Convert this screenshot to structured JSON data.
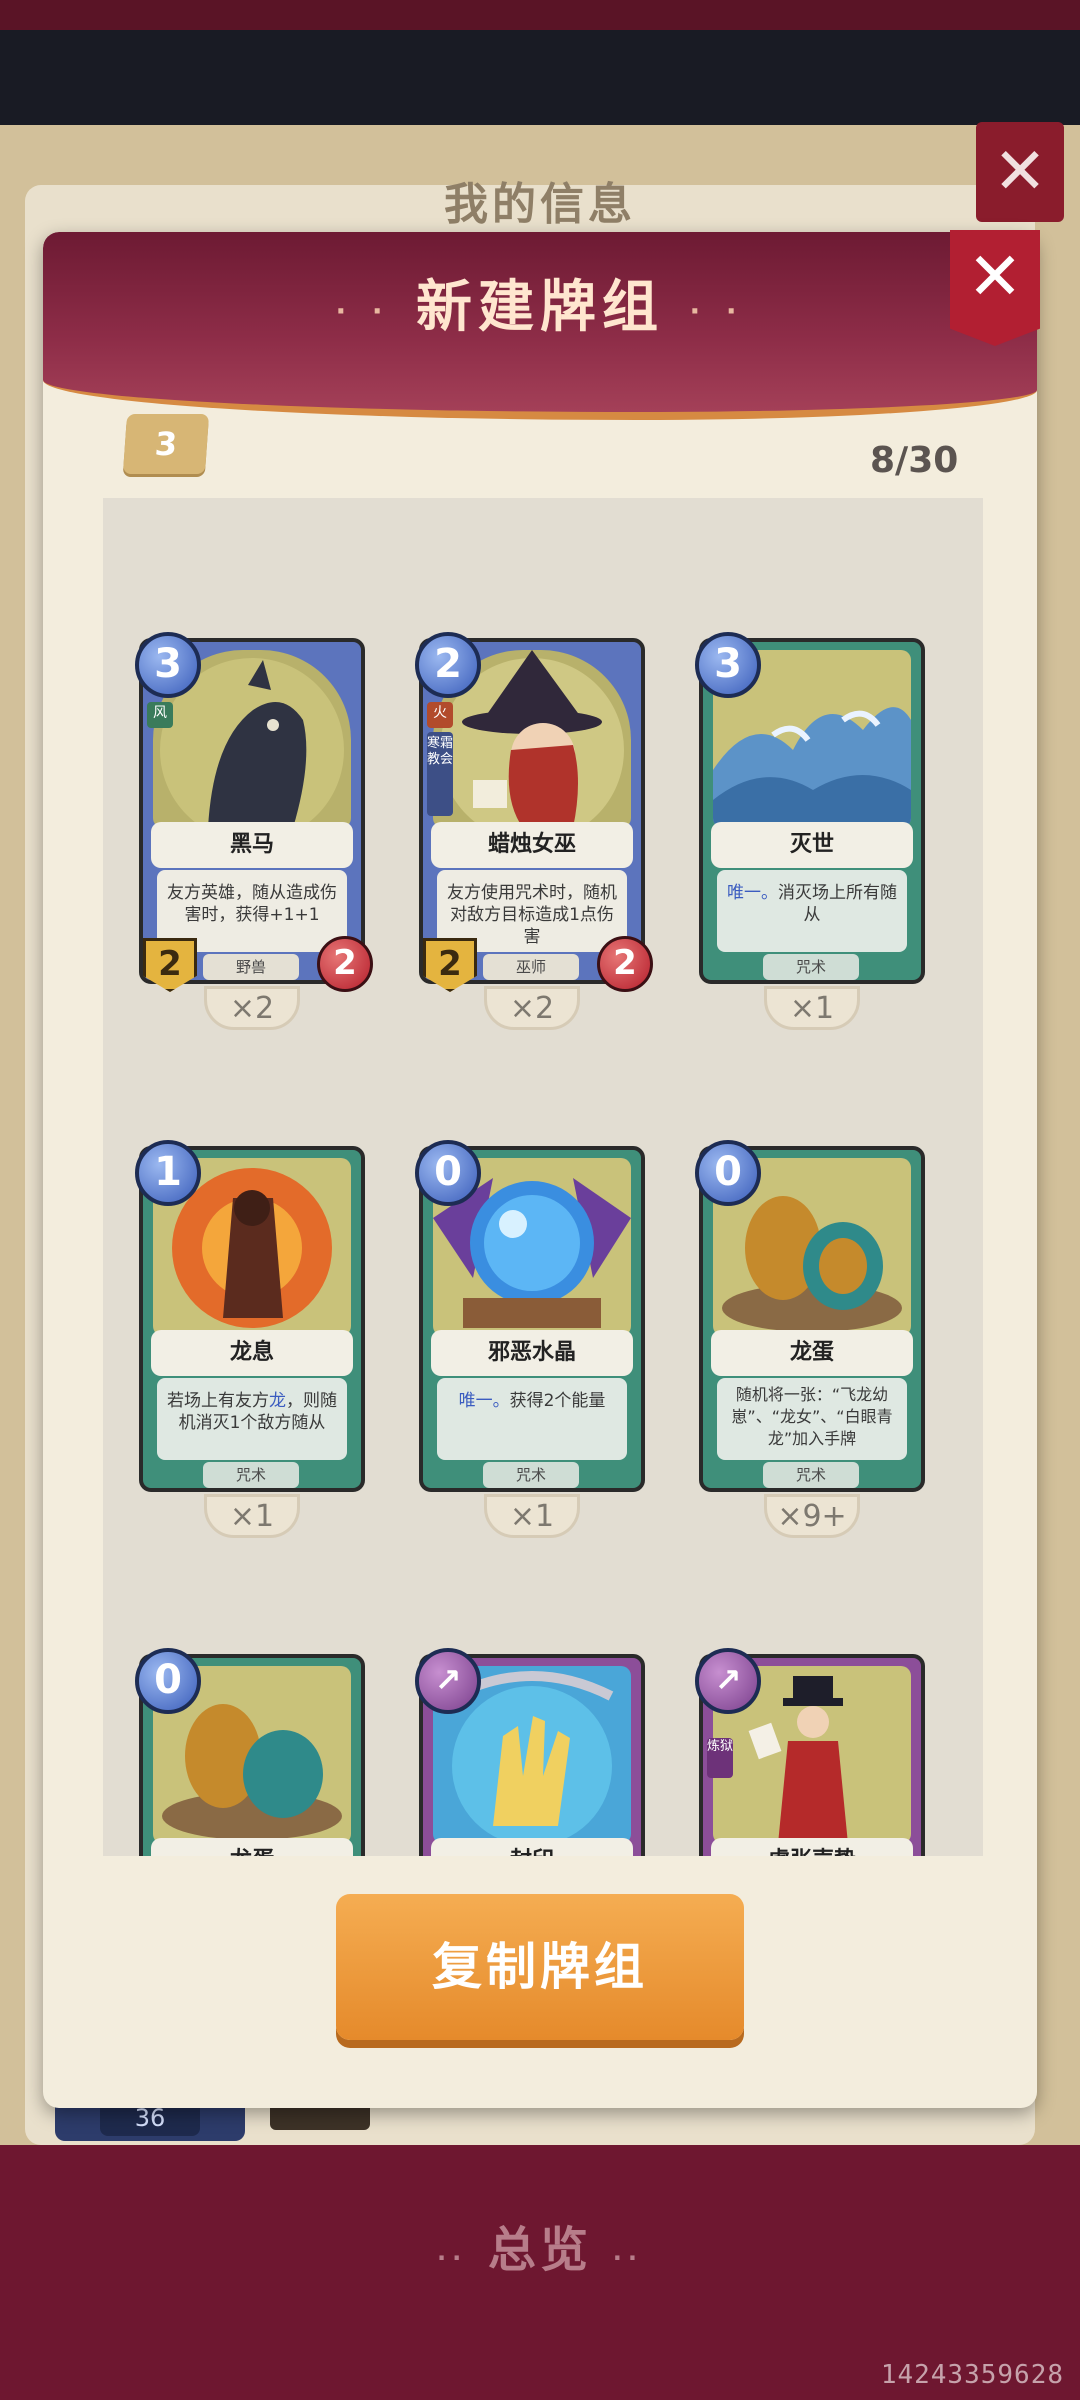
{
  "background": {
    "title": "我的信息",
    "bottom_title": "总览",
    "chip_number": "36",
    "footer_id": "14243359628"
  },
  "dialog": {
    "title": "新建牌组",
    "deck_cost": "3",
    "card_count": "8/30",
    "copy_button": "复制牌组"
  },
  "cards": [
    {
      "name": "黑马",
      "cost": "3",
      "desc": "友方英雄，随从造成伤害时，获得+1+1",
      "type": "野兽",
      "attack": "2",
      "health": "2",
      "tag": "风",
      "multiplier": "×2",
      "color": "blue"
    },
    {
      "name": "蜡烛女巫",
      "cost": "2",
      "desc": "友方使用咒术时，随机对敌方目标造成1点伤害",
      "type": "巫师",
      "attack": "2",
      "health": "2",
      "tag": "火",
      "tag2": "寒霜教会",
      "multiplier": "×2",
      "color": "blue"
    },
    {
      "name": "灭世",
      "cost": "3",
      "desc_hl": "唯一。",
      "desc": "消灭场上所有随从",
      "type": "咒术",
      "multiplier": "×1",
      "color": "green"
    },
    {
      "name": "龙息",
      "cost": "1",
      "desc_pre": "若场上有友方",
      "desc_hl": "龙",
      "desc": "，则随机消灭1个敌方随从",
      "type": "咒术",
      "multiplier": "×1",
      "color": "green"
    },
    {
      "name": "邪恶水晶",
      "cost": "0",
      "desc_hl": "唯一。",
      "desc": "获得2个能量",
      "type": "咒术",
      "multiplier": "×1",
      "color": "green"
    },
    {
      "name": "龙蛋",
      "cost": "0",
      "desc": "随机将一张：“飞龙幼崽”、“龙女”、“白眼青龙”加入手牌",
      "type": "咒术",
      "multiplier": "×9+",
      "color": "green"
    },
    {
      "name": "龙蛋",
      "cost": "0",
      "color": "green"
    },
    {
      "name": "封印",
      "color": "purple"
    },
    {
      "name": "虚张声势",
      "tag": "炼狱",
      "color": "purple"
    }
  ],
  "colors": {
    "accent": "#e58a2b",
    "header": "#7a1d35",
    "blue_card": "#5c74bd",
    "green_card": "#3f8f7a",
    "purple_card": "#8c4e99"
  }
}
